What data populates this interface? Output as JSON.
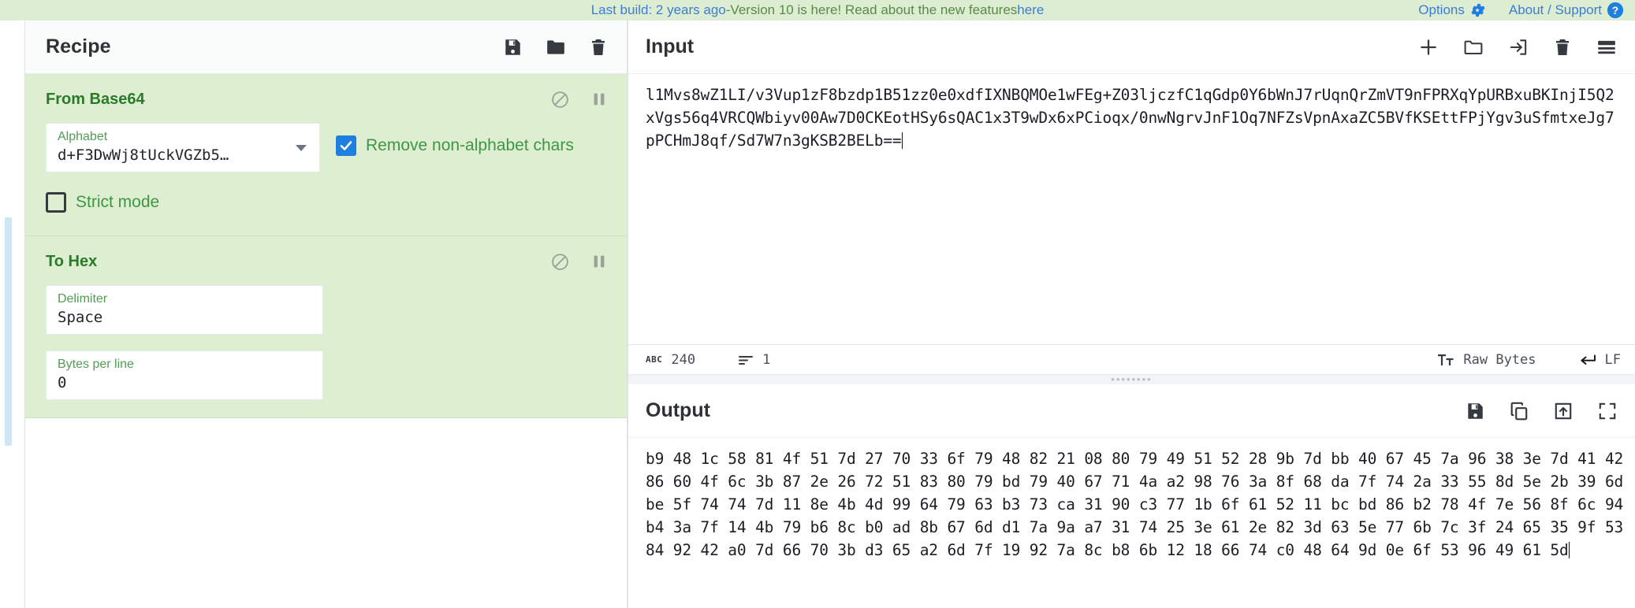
{
  "banner": {
    "build_text": "Last build: 2 years ago",
    "separator": " - ",
    "version_text": "Version 10 is here! Read about the new features ",
    "link_text": "here",
    "options_label": "Options",
    "about_label": "About / Support",
    "link_color": "#3b7dd8",
    "text_color": "#5a8a4a",
    "background": "#dcedd2"
  },
  "recipe": {
    "title": "Recipe",
    "tools": [
      {
        "name": "save-recipe-icon",
        "label": "Save recipe"
      },
      {
        "name": "load-recipe-icon",
        "label": "Load recipe"
      },
      {
        "name": "clear-recipe-icon",
        "label": "Clear recipe"
      }
    ],
    "operations": [
      {
        "title": "From Base64",
        "icons": [
          {
            "name": "disable-operation-icon",
            "label": "Disable operation"
          },
          {
            "name": "breakpoint-icon",
            "label": "Set breakpoint"
          }
        ],
        "args": {
          "alphabet": {
            "label": "Alphabet",
            "value": "d+F3DwWj8tUckVGZb5…"
          },
          "remove_non_alphabet": {
            "label": "Remove non-alphabet chars",
            "checked": true
          },
          "strict_mode": {
            "label": "Strict mode",
            "checked": false
          }
        }
      },
      {
        "title": "To Hex",
        "icons": [
          {
            "name": "disable-operation-icon",
            "label": "Disable operation"
          },
          {
            "name": "breakpoint-icon",
            "label": "Set breakpoint"
          }
        ],
        "args": {
          "delimiter": {
            "label": "Delimiter",
            "value": "Space"
          },
          "bytes_per_line": {
            "label": "Bytes per line",
            "value": "0"
          }
        }
      }
    ]
  },
  "input": {
    "title": "Input",
    "tools": [
      {
        "name": "add-input-tab-icon",
        "label": "Add a new input tab"
      },
      {
        "name": "open-folder-as-input-icon",
        "label": "Open folder as input"
      },
      {
        "name": "open-file-as-input-icon",
        "label": "Open file as input"
      },
      {
        "name": "clear-input-icon",
        "label": "Clear input and output"
      },
      {
        "name": "reset-pane-layout-icon",
        "label": "Reset pane layout"
      }
    ],
    "value": "l1Mvs8wZ1LI/v3Vup1zF8bzdp1B51zz0e0xdfIXNBQMOe1wFEg+Z03ljczfC1qGdp0Y6bWnJ7rUqnQrZmVT9nFPRXqYpURBxuBKInjI5Q2xVgs56q4VRCQWbiyv00Aw7D0CKEotHSy6sQAC1x3T9wDx6xPCioqx/0nwNgrvJnF1Oq7NFZsVpnAxaZC5BVfKSEttFPjYgv3uSfmtxeJg7pPCHmJ8qf/Sd7W7n3gKSB2BELb==",
    "status": {
      "length_label": "240",
      "lines_label": "1",
      "length_icon": "character-count-icon",
      "lines_icon": "line-count-icon",
      "encoding_icon": "input-character-encoding-icon",
      "encoding_label": "Raw Bytes",
      "eol_icon": "line-ending-icon",
      "eol_label": "LF"
    }
  },
  "output": {
    "title": "Output",
    "tools": [
      {
        "name": "save-output-icon",
        "label": "Save output to file"
      },
      {
        "name": "copy-output-icon",
        "label": "Copy raw output to the clipboard"
      },
      {
        "name": "replace-input-with-output-icon",
        "label": "Replace input with output"
      },
      {
        "name": "maximise-output-icon",
        "label": "Maximise output pane"
      }
    ],
    "lines": [
      "b9 48 1c 58 81 4f 51 7d 27 70 33 6f 79 48 82 21 08 80 79 49 51 52 28 9b 7d bb 40 67 45 7a 96 38 3e 7d 41 42",
      "86 60 4f 6c 3b 87 2e 26 72 51 83 80 79 bd 79 40 67 71 4a a2 98 76 3a 8f 68 da 7f 74 2a 33 55 8d 5e 2b 39 6d",
      "be 5f 74 74 7d 11 8e 4b 4d 99 64 79 63 b3 73 ca 31 90 c3 77 1b 6f 61 52 11 bc bd 86 b2 78 4f 7e 56 8f 6c 94",
      "b4 3a 7f 14 4b 79 b6 8c b0 ad 8b 67 6d d1 7a 9a a7 31 74 25 3e 61 2e 82 3d 63 5e 77 6b 7c 3f 24 65 35 9f 53",
      "84 92 42 a0 7d 66 70 3b d3 65 a2 6d 7f 19 92 7a 8c b8 6b 12 18 66 74 c0 48 64 9d 0e 6f 53 96 49 61 5d"
    ]
  }
}
